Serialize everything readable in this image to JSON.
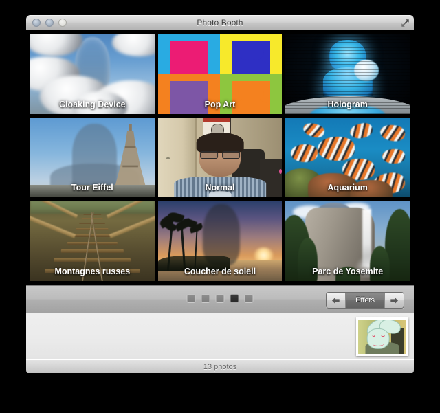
{
  "window": {
    "title": "Photo Booth",
    "controls": {
      "close": "close-button",
      "minimize": "minimize-button",
      "zoom": "zoom-button",
      "fullscreen": "fullscreen-button"
    }
  },
  "effects": {
    "items": [
      {
        "label": "Cloaking Device",
        "scene": "clouds"
      },
      {
        "label": "Pop Art",
        "scene": "popart"
      },
      {
        "label": "Hologram",
        "scene": "hologram"
      },
      {
        "label": "Tour Eiffel",
        "scene": "eiffel"
      },
      {
        "label": "Normal",
        "scene": "webcam"
      },
      {
        "label": "Aquarium",
        "scene": "aquarium"
      },
      {
        "label": "Montagnes russes",
        "scene": "coaster"
      },
      {
        "label": "Coucher de soleil",
        "scene": "sunset"
      },
      {
        "label": "Parc de Yosemite",
        "scene": "yosemite"
      }
    ],
    "popart_colors": [
      {
        "bg": "#29ABE2",
        "figure": "#EC1C74"
      },
      {
        "bg": "#F7E92B",
        "figure": "#2E2FC4"
      },
      {
        "bg": "#F4811F",
        "figure": "#7D56A6"
      },
      {
        "bg": "#8DC63F",
        "figure": "#F4811F"
      }
    ]
  },
  "toolbar": {
    "pages": {
      "count": 5,
      "active_index": 3
    },
    "effects_label": "Effets",
    "prev_label": "←",
    "next_label": "→"
  },
  "statusbar": {
    "photo_count_text": "13 photos"
  },
  "colors": {
    "desktop": "#000000",
    "titlebar_text": "#3d3d3d",
    "grid_background": "#000000",
    "toolbar_gray": "#b4b4b4",
    "effects_segment": "#6e6e6e",
    "status_text": "#666666"
  }
}
